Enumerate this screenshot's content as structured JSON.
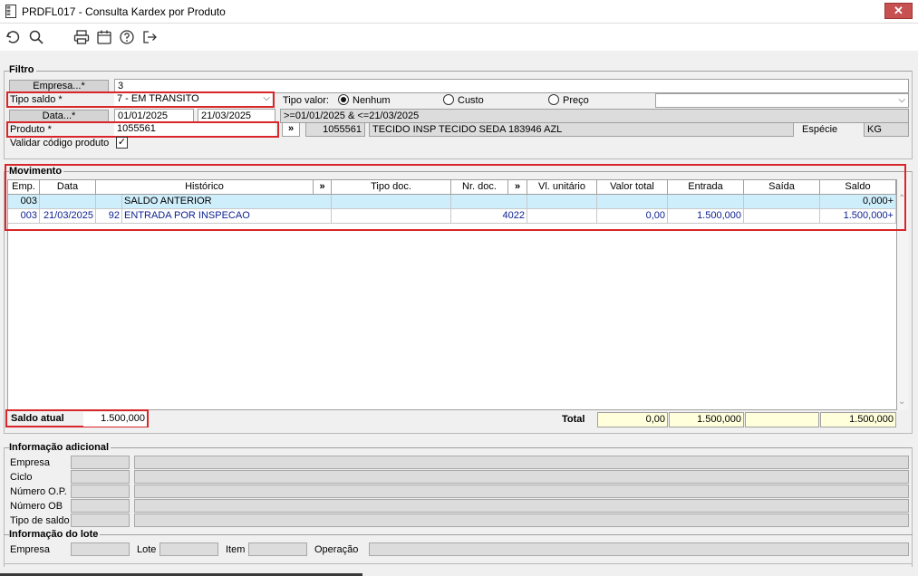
{
  "window": {
    "title": "PRDFL017 - Consulta Kardex por Produto",
    "close_label": "✕"
  },
  "toolbar": {
    "icons": [
      "undo-icon",
      "search-icon",
      "print-icon",
      "calendar-icon",
      "help-icon",
      "exit-icon"
    ]
  },
  "filtro": {
    "title": "Filtro",
    "empresa_label": "Empresa...*",
    "empresa_value": "3",
    "tipo_saldo_label": "Tipo saldo *",
    "tipo_saldo_value": "7 - EM TRANSITO",
    "tipo_valor_label": "Tipo valor:",
    "tipo_valor_options": [
      "Nenhum",
      "Custo",
      "Preço"
    ],
    "tipo_valor_selected": "Nenhum",
    "data_label": "Data...*",
    "data_inicio": "01/01/2025",
    "data_fim": "21/03/2025",
    "data_expr": ">=01/01/2025 & <=21/03/2025",
    "produto_label": "Produto *",
    "produto_value": "1055561",
    "produto_btn": "»",
    "produto_code": "1055561",
    "produto_desc": "TECIDO INSP TECIDO SEDA 183946 AZL",
    "especie_label": "Espécie",
    "especie_value": "KG",
    "validar_label": "Validar código produto",
    "validar_checked": true
  },
  "movimento": {
    "title": "Movimento",
    "columns": [
      "Emp.",
      "Data",
      "Histórico",
      "»",
      "Tipo doc.",
      "Nr. doc.",
      "»",
      "Vl. unitário",
      "Valor total",
      "Entrada",
      "Saída",
      "Saldo"
    ],
    "rows": [
      {
        "emp": "003",
        "data": "",
        "num": "",
        "historico": "SALDO ANTERIOR",
        "tipo_doc": "",
        "nr_doc": "",
        "vl_unit": "",
        "valor_total": "",
        "entrada": "",
        "saida": "",
        "saldo": "0,000+"
      },
      {
        "emp": "003",
        "data": "21/03/2025",
        "num": "92",
        "historico": "ENTRADA POR INSPECAO",
        "tipo_doc": "",
        "nr_doc": "4022",
        "vl_unit": "",
        "valor_total": "0,00",
        "entrada": "1.500,000",
        "saida": "",
        "saldo": "1.500,000+"
      }
    ],
    "saldo_atual_label": "Saldo atual",
    "saldo_atual_value": "1.500,000",
    "total_label": "Total",
    "total_valor": "0,00",
    "total_entrada": "1.500,000",
    "total_saida": "",
    "total_saldo": "1.500,000"
  },
  "info_adicional": {
    "title": "Informação adicional",
    "labels": [
      "Empresa",
      "Ciclo",
      "Número O.P.",
      "Número OB",
      "Tipo de saldo"
    ]
  },
  "info_lote": {
    "title": "Informação do lote",
    "empresa_label": "Empresa",
    "lote_label": "Lote",
    "item_label": "Item",
    "operacao_label": "Operação"
  },
  "colors": {
    "highlight_red": "#d8262a",
    "row_highlight": "#cfeefc",
    "total_fill": "#ffffdc",
    "close_red": "#c75050"
  }
}
